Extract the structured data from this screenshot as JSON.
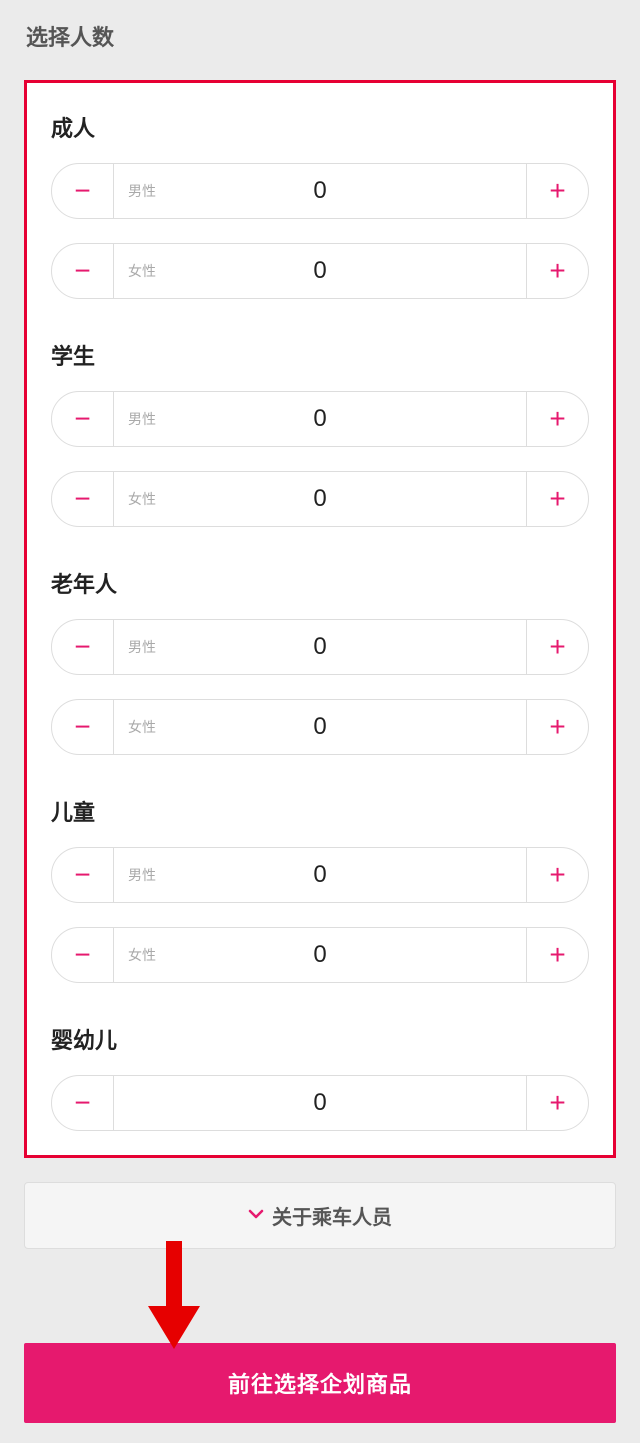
{
  "title": "选择人数",
  "colors": {
    "accent": "#e6196e",
    "border_highlight": "#e60033"
  },
  "categories": [
    {
      "key": "adult",
      "label": "成人",
      "rows": [
        {
          "key": "male",
          "label": "男性",
          "value": 0
        },
        {
          "key": "female",
          "label": "女性",
          "value": 0
        }
      ]
    },
    {
      "key": "student",
      "label": "学生",
      "rows": [
        {
          "key": "male",
          "label": "男性",
          "value": 0
        },
        {
          "key": "female",
          "label": "女性",
          "value": 0
        }
      ]
    },
    {
      "key": "senior",
      "label": "老年人",
      "rows": [
        {
          "key": "male",
          "label": "男性",
          "value": 0
        },
        {
          "key": "female",
          "label": "女性",
          "value": 0
        }
      ]
    },
    {
      "key": "child",
      "label": "儿童",
      "rows": [
        {
          "key": "male",
          "label": "男性",
          "value": 0
        },
        {
          "key": "female",
          "label": "女性",
          "value": 0
        }
      ]
    },
    {
      "key": "infant",
      "label": "婴幼儿",
      "rows": [
        {
          "key": "any",
          "label": "",
          "value": 0
        }
      ]
    }
  ],
  "infoPanel": {
    "label": "关于乘车人员",
    "icon": "chevron-down"
  },
  "primaryButton": {
    "label": "前往选择企划商品"
  },
  "glyphs": {
    "minus": "−",
    "plus": "+"
  }
}
